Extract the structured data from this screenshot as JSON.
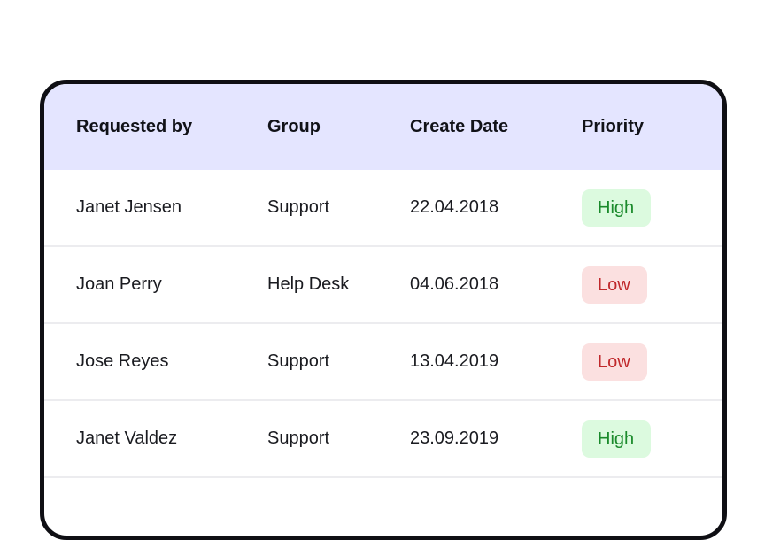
{
  "table": {
    "columns": [
      "Requested by",
      "Group",
      "Create Date",
      "Priority"
    ],
    "rows": [
      {
        "requested_by": "Janet Jensen",
        "group": "Support",
        "create_date": "22.04.2018",
        "priority": "High",
        "priority_level": "high"
      },
      {
        "requested_by": "Joan Perry",
        "group": "Help Desk",
        "create_date": "04.06.2018",
        "priority": "Low",
        "priority_level": "low"
      },
      {
        "requested_by": "Jose Reyes",
        "group": "Support",
        "create_date": "13.04.2019",
        "priority": "Low",
        "priority_level": "low"
      },
      {
        "requested_by": "Janet Valdez",
        "group": "Support",
        "create_date": "23.09.2019",
        "priority": "High",
        "priority_level": "high"
      }
    ]
  },
  "colors": {
    "header_bg": "#e4e5ff",
    "high_bg": "#dcfadf",
    "high_text": "#1a8a2b",
    "low_bg": "#fbe0e0",
    "low_text": "#c0282b",
    "border": "#0f0f14"
  }
}
